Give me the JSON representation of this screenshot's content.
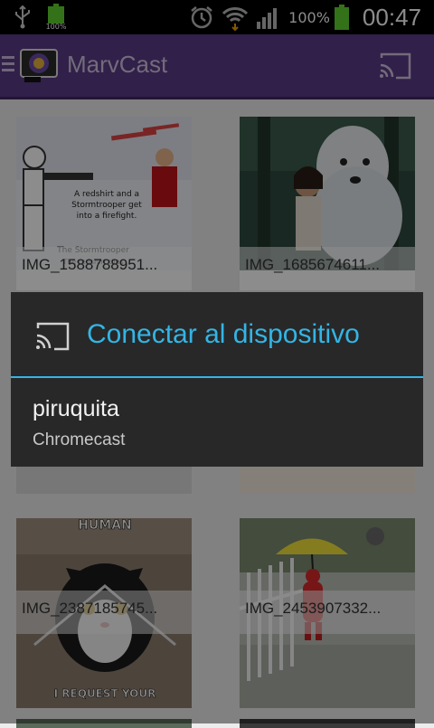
{
  "status_bar": {
    "battery_small_percent": "100%",
    "battery_percent": "100%",
    "time": "00:47",
    "icons": [
      "usb-icon",
      "battery-icon",
      "alarm-icon",
      "wifi-icon",
      "signal-icon",
      "battery-icon"
    ]
  },
  "action_bar": {
    "title": "MarvCast",
    "icons": [
      "menu-icon",
      "app-logo-icon",
      "cast-icon"
    ],
    "color": "#5a3b86"
  },
  "grid": {
    "items": [
      {
        "caption": "IMG_1588788951..."
      },
      {
        "caption": "IMG_1685674611..."
      },
      {
        "caption": ""
      },
      {
        "caption": ""
      },
      {
        "caption": "IMG_2387185745..."
      },
      {
        "caption": "IMG_2453907332..."
      }
    ],
    "image_texts": {
      "meme1": "A redshirt and a Stormtrooper get into a firefight.",
      "meme1_bottom": "The Stormtrooper ... The redshirt dies anyway.",
      "cat_top": "HUMAN",
      "cat_bottom": "I REQUEST YOUR"
    }
  },
  "dialog": {
    "title": "Conectar al dispositivo",
    "accent_color": "#33b5e5",
    "icon": "cast-icon",
    "devices": [
      {
        "name": "piruquita",
        "type": "Chromecast"
      }
    ]
  }
}
